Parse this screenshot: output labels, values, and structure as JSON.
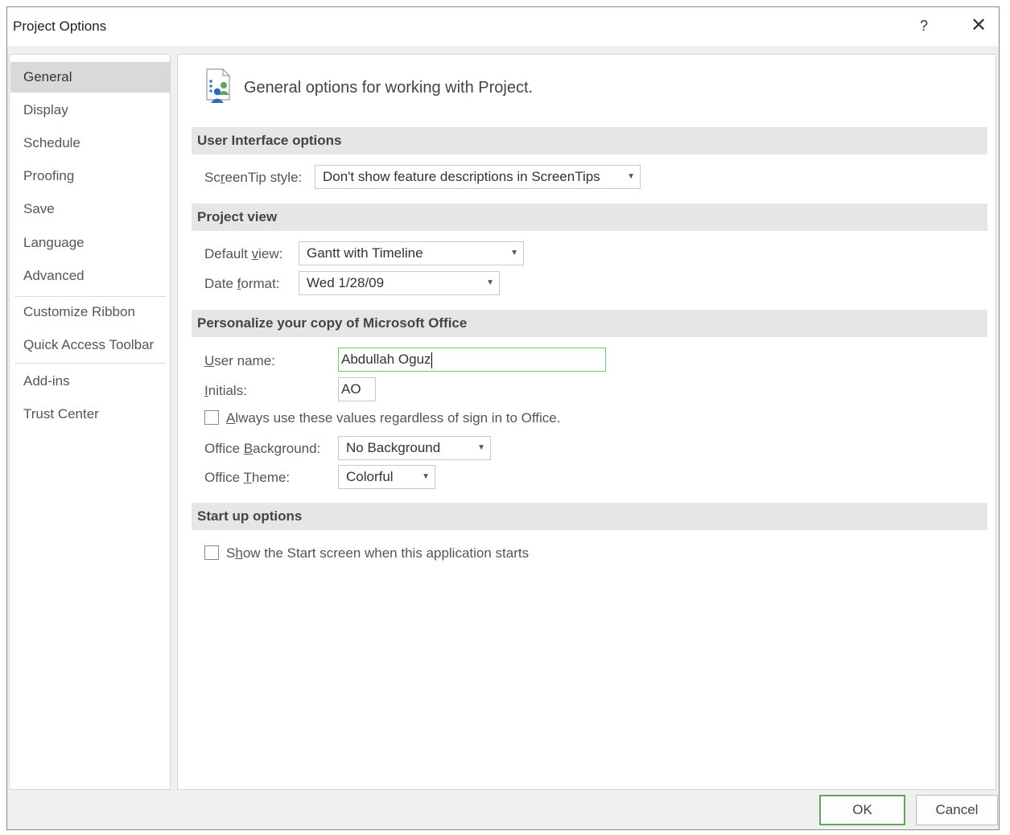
{
  "window": {
    "title": "Project Options",
    "help_glyph": "?",
    "close_glyph": "✕"
  },
  "nav": {
    "items": [
      {
        "label": "General",
        "selected": true
      },
      {
        "label": "Display"
      },
      {
        "label": "Schedule"
      },
      {
        "label": "Proofing"
      },
      {
        "label": "Save"
      },
      {
        "label": "Language"
      },
      {
        "label": "Advanced"
      },
      {
        "label": "Customize Ribbon"
      },
      {
        "label": "Quick Access Toolbar"
      },
      {
        "label": "Add-ins"
      },
      {
        "label": "Trust Center"
      }
    ]
  },
  "header": {
    "text": "General options for working with Project.",
    "icon": "people-options-icon"
  },
  "sections": {
    "ui_options": {
      "title": "User Interface options",
      "screentip_label_pre": "Sc",
      "screentip_label_u": "r",
      "screentip_label_post": "eenTip style:",
      "screentip_value": "Don't show feature descriptions in ScreenTips"
    },
    "project_view": {
      "title": "Project view",
      "default_view_pre": "Default ",
      "default_view_u": "v",
      "default_view_post": "iew:",
      "default_view_value": "Gantt with Timeline",
      "date_format_pre": "Date ",
      "date_format_u": "f",
      "date_format_post": "ormat:",
      "date_format_value": "Wed 1/28/09"
    },
    "personalize": {
      "title": "Personalize your copy of Microsoft Office",
      "username_u": "U",
      "username_post": "ser name:",
      "username_value": "Abdullah Oguz",
      "initials_u": "I",
      "initials_post": "nitials:",
      "initials_value": "AO",
      "always_use_u": "A",
      "always_use_post": "lways use these values regardless of sign in to Office.",
      "always_use_checked": false,
      "background_pre": "Office ",
      "background_u": "B",
      "background_post": "ackground:",
      "background_value": "No Background",
      "theme_pre": "Office ",
      "theme_u": "T",
      "theme_post": "heme:",
      "theme_value": "Colorful"
    },
    "startup": {
      "title": "Start up options",
      "show_start_pre": "S",
      "show_start_u": "h",
      "show_start_post": "ow the Start screen when this application starts",
      "show_start_checked": false
    }
  },
  "buttons": {
    "ok": "OK",
    "cancel": "Cancel"
  },
  "colors": {
    "selected_nav": "#d9d9d9",
    "section_bg": "#e6e6e6",
    "default_button_border": "#5fa55f"
  }
}
